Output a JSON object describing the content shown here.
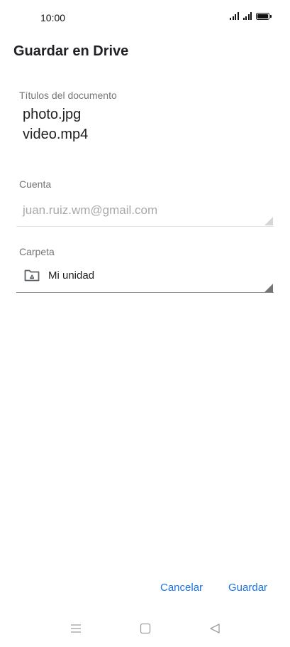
{
  "status_bar": {
    "time": "10:00",
    "icons": [
      "signal-icon",
      "signal-icon",
      "battery-icon"
    ]
  },
  "dialog": {
    "title": "Guardar en Drive"
  },
  "document": {
    "label": "Títulos del documento",
    "titles": [
      "photo.jpg",
      "video.mp4"
    ]
  },
  "account": {
    "label": "Cuenta",
    "value": "juan.ruiz.wm@gmail.com"
  },
  "folder": {
    "label": "Carpeta",
    "value": "Mi unidad",
    "icon": "drive-folder-icon"
  },
  "buttons": {
    "cancel": "Cancelar",
    "save": "Guardar"
  },
  "colors": {
    "accent": "#1a73e8",
    "text": "#202124",
    "label": "#757575",
    "disabled": "#a8a8a8"
  },
  "nav_bar": {
    "icons": [
      "menu-icon",
      "home-icon",
      "back-icon"
    ]
  }
}
